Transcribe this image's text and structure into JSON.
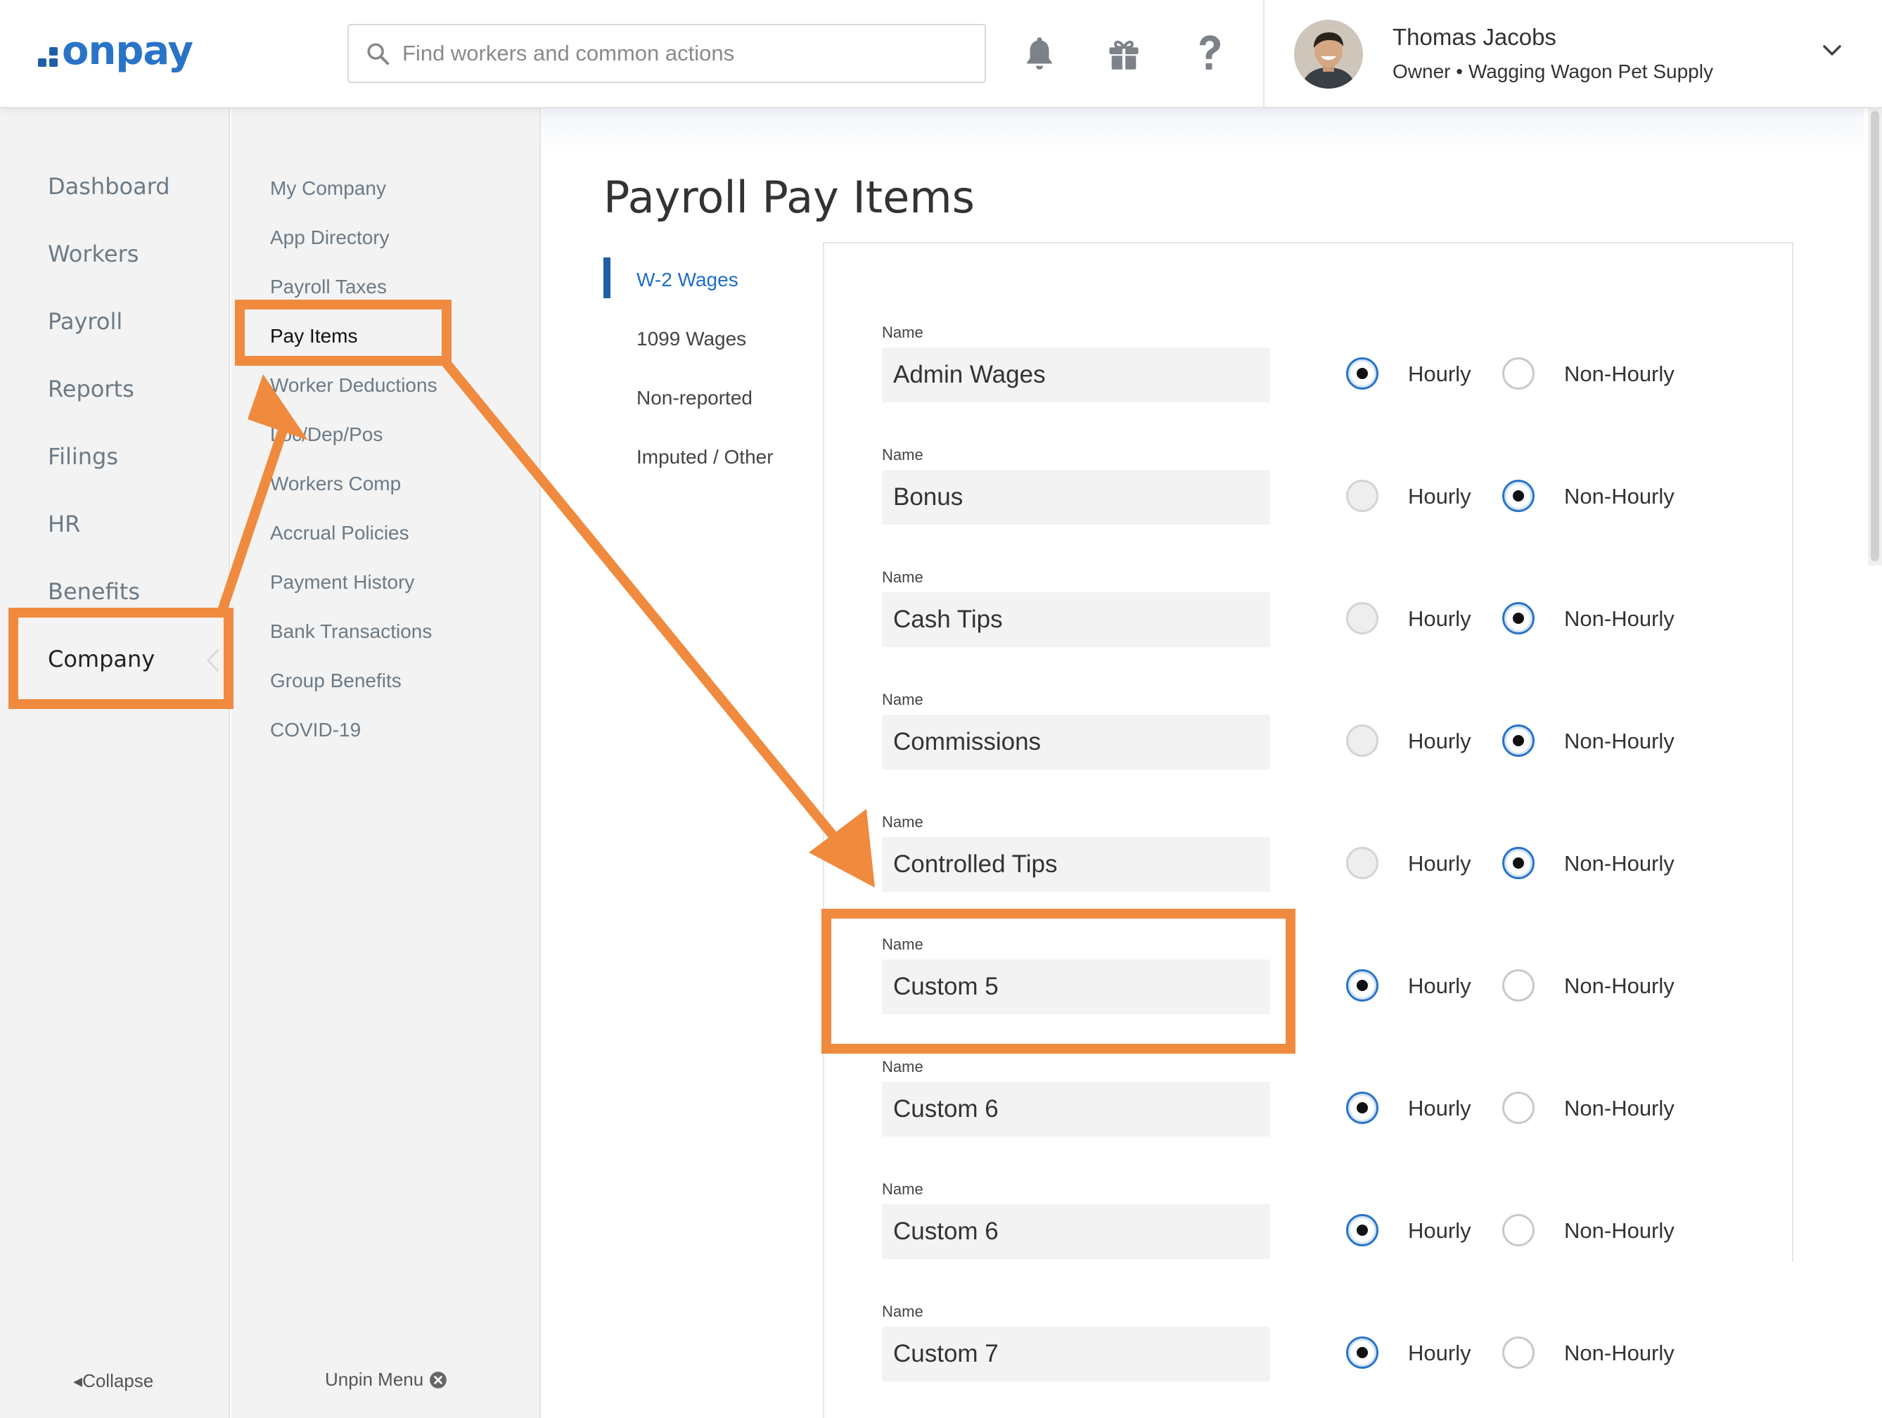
{
  "header": {
    "logo_text": "onpay",
    "search_placeholder": "Find workers and common actions",
    "icons": [
      "bell-icon",
      "gift-icon",
      "help-icon"
    ],
    "user": {
      "name": "Thomas Jacobs",
      "subtitle": "Owner • Wagging Wagon Pet Supply"
    }
  },
  "nav_primary": {
    "items": [
      "Dashboard",
      "Workers",
      "Payroll",
      "Reports",
      "Filings",
      "HR",
      "Benefits",
      "Company"
    ],
    "active": "Company",
    "collapse_label": "Collapse"
  },
  "nav_secondary": {
    "items": [
      "My Company",
      "App Directory",
      "Payroll Taxes",
      "Pay Items",
      "Worker Deductions",
      "Loc/Dep/Pos",
      "Workers Comp",
      "Accrual Policies",
      "Payment History",
      "Bank Transactions",
      "Group Benefits",
      "COVID-19"
    ],
    "active": "Pay Items",
    "unpin_label": "Unpin Menu"
  },
  "main": {
    "title": "Payroll Pay Items",
    "tabs": [
      "W-2 Wages",
      "1099 Wages",
      "Non-reported",
      "Imputed / Other"
    ],
    "active_tab": "W-2 Wages",
    "field_label": "Name",
    "option_hourly": "Hourly",
    "option_non_hourly": "Non-Hourly",
    "rows": [
      {
        "name": "Admin Wages",
        "type": "Hourly"
      },
      {
        "name": "Bonus",
        "type": "Non-Hourly"
      },
      {
        "name": "Cash Tips",
        "type": "Non-Hourly"
      },
      {
        "name": "Commissions",
        "type": "Non-Hourly"
      },
      {
        "name": "Controlled Tips",
        "type": "Non-Hourly"
      },
      {
        "name": "Custom 5",
        "type": "Hourly"
      },
      {
        "name": "Custom 6",
        "type": "Hourly"
      },
      {
        "name": "Custom 6",
        "type": "Hourly"
      },
      {
        "name": "Custom 7",
        "type": "Hourly"
      }
    ]
  },
  "annotation_color": "#ef8a3e"
}
